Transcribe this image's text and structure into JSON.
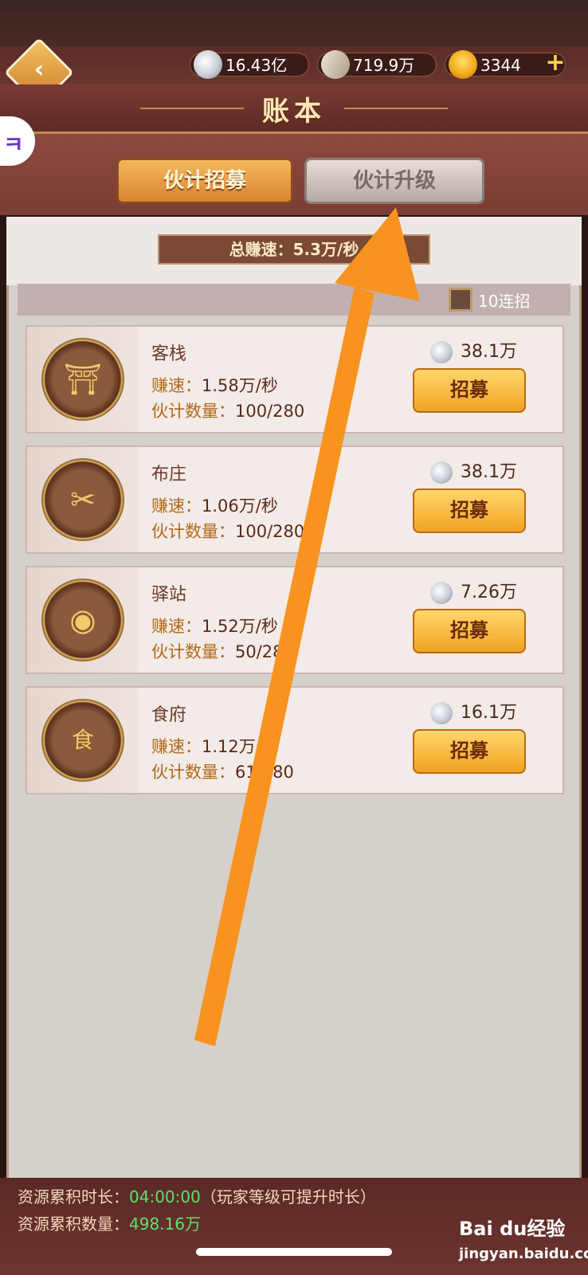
{
  "hud": {
    "silver": "16.43亿",
    "scrolls": "719.9万",
    "gold": "3344",
    "plus": "+"
  },
  "title": "账本",
  "tabs": [
    {
      "label": "伙计招募"
    },
    {
      "label": "伙计升级"
    }
  ],
  "total_speed": "总赚速：5.3万/秒",
  "ten_pull": {
    "label": "10连招"
  },
  "rate_prefix": "赚速：",
  "count_prefix": "伙计数量：",
  "recruit_label": "招募",
  "cards": [
    {
      "name": "客栈",
      "rate": "1.58万/秒",
      "count": "100/280",
      "cost": "38.1万",
      "glyph": "⛩"
    },
    {
      "name": "布庄",
      "rate": "1.06万/秒",
      "count": "100/280",
      "cost": "38.1万",
      "glyph": "✂"
    },
    {
      "name": "驿站",
      "rate": "1.52万/秒",
      "count": "50/280",
      "cost": "7.26万",
      "glyph": "◉"
    },
    {
      "name": "食府",
      "rate": "1.12万/秒",
      "count": "61/280",
      "cost": "16.1万",
      "glyph": "食"
    }
  ],
  "bottom": {
    "time_label": "资源累积时长：",
    "time_value": "04:00:00",
    "time_note": "（玩家等级可提升时长）",
    "amount_label": "资源累积数量：",
    "amount_value": "498.16万"
  },
  "watermark": {
    "brand": "Bai du经验",
    "url": "jingyan.baidu.com"
  },
  "colors": {
    "accent_arrow": "#f7931e",
    "gold_button": "#f1a323",
    "active_green": "#5fe06a"
  }
}
